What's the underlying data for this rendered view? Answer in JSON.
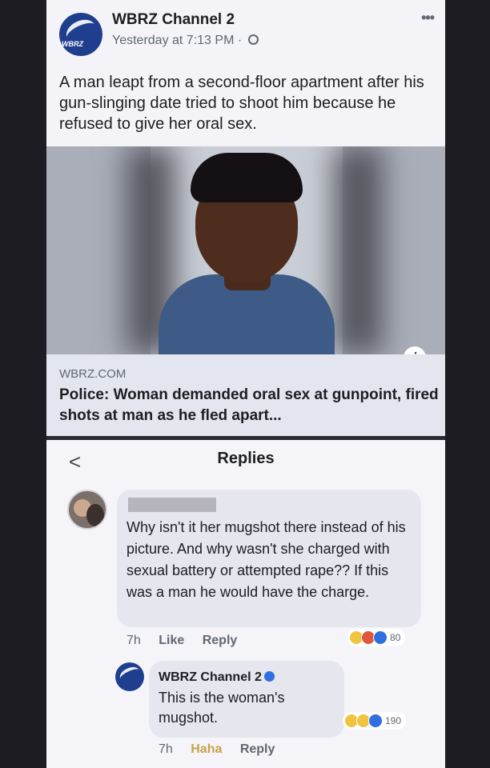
{
  "post": {
    "page_name": "WBRZ Channel 2",
    "logo_text": "WBRZ",
    "timestamp": "Yesterday at 7:13 PM",
    "meta_separator": "·",
    "more_glyph": "•••",
    "text": "A man leapt from a second-floor apartment after his gun-slinging date tried to shoot him because he refused to give her oral sex.",
    "link": {
      "domain": "WBRZ.COM",
      "title": "Police: Woman demanded oral sex at gunpoint, fired shots at man as he fled apart..."
    },
    "info_glyph": "i"
  },
  "replies": {
    "title": "Replies",
    "back_glyph": "<",
    "comment": {
      "text": "Why isn't it her mugshot there instead of his picture. And why wasn't she charged with sexual battery or attempted rape?? If this was a man he would have the charge.",
      "time": "7h",
      "like_label": "Like",
      "reply_label": "Reply",
      "reaction_count": "80",
      "reactions": [
        "wow-icon",
        "angry-icon",
        "like-icon"
      ]
    },
    "page_reply": {
      "name": "WBRZ Channel 2",
      "text": "This is the woman's mugshot.",
      "time": "7h",
      "haha_label": "Haha",
      "reply_label": "Reply",
      "reaction_count": "190",
      "reactions": [
        "haha-icon",
        "wow-icon",
        "like-icon"
      ]
    }
  },
  "colors": {
    "brand_blue": "#1f3f8e",
    "link_blue": "#2f6fe0",
    "background": "#1c1c22"
  }
}
